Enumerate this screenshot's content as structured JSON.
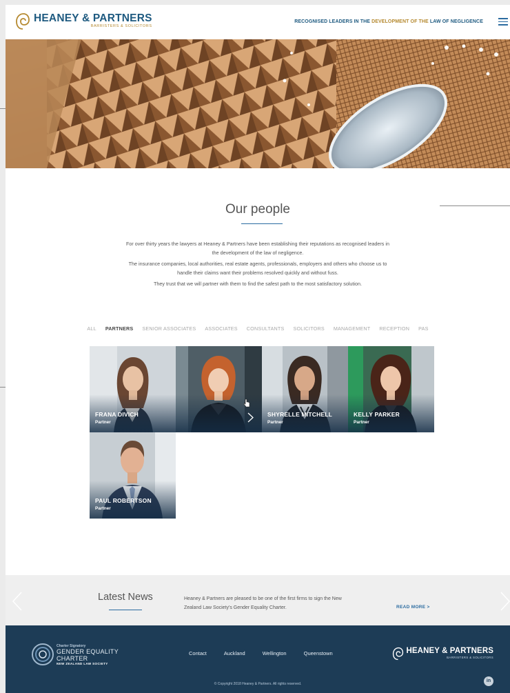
{
  "header": {
    "logo_name": "HEANEY & PARTNERS",
    "logo_sub": "BARRISTERS & SOLICITORS",
    "tagline": {
      "part1": "RECOGNISED LEADERS IN THE ",
      "part2": "DEVELOPMENT OF THE",
      "part3": " LAW OF NEGLIGENCE"
    },
    "menu_icon": "hamburger-menu-icon"
  },
  "hero": {
    "image": "architectural-wooden-ceiling-photo"
  },
  "people": {
    "title": "Our people",
    "intro": [
      "For over thirty years the lawyers at Heaney & Partners have been establishing their reputations as recognised leaders in the development of the law of negligence.",
      "The insurance companies, local authorities, real estate agents, professionals, employers and others who choose us to handle their claims want their problems resolved quickly and without fuss.",
      "They trust that we will partner with them to find the safest path to the most satisfactory solution."
    ],
    "filters": [
      "ALL",
      "PARTNERS",
      "SENIOR ASSOCIATES",
      "ASSOCIATES",
      "CONSULTANTS",
      "SOLICITORS",
      "MANAGEMENT",
      "RECEPTION",
      "PAS"
    ],
    "active_filter": "PARTNERS",
    "cards": [
      {
        "name": "FRANA DIVICH",
        "role": "Partner"
      },
      {
        "name": "",
        "role": ""
      },
      {
        "name": "SHYRELLE MITCHELL",
        "role": "Partner"
      },
      {
        "name": "KELLY PARKER",
        "role": "Partner"
      },
      {
        "name": "PAUL ROBERTSON",
        "role": "Partner"
      }
    ]
  },
  "news": {
    "title": "Latest News",
    "text": "Heaney & Partners are pleased to be one of the first firms to sign the New Zealand Law Society's Gender Equality Charter.",
    "read_more": "READ MORE  >"
  },
  "footer": {
    "charter_small": "Charter Signatory",
    "charter_line1": "GENDER EQUALITY",
    "charter_line2": "CHARTER",
    "charter_nz": "NEW ZEALAND LAW SOCIETY",
    "links": [
      "Contact",
      "Auckland",
      "Wellington",
      "Queenstown"
    ],
    "logo_name": "HEANEY & PARTNERS",
    "logo_sub": "BARRISTERS & SOLICITORS",
    "copyright": "© Copyright 2018 Heaney & Partners. All rights reserved.",
    "social": "in"
  },
  "colors": {
    "brand_blue": "#1e5a80",
    "brand_gold": "#b5892f",
    "footer_bg": "#1d3c56"
  }
}
